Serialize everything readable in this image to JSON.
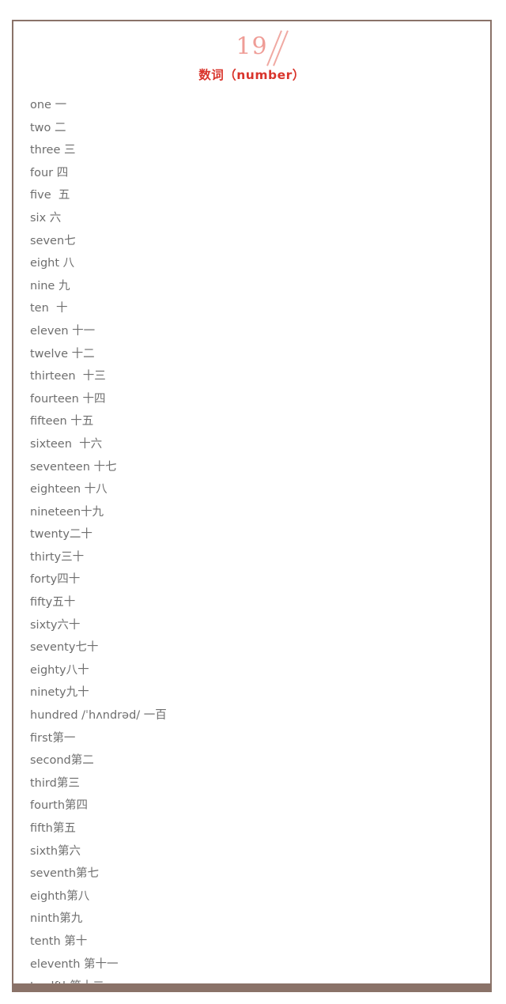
{
  "header": {
    "chapter_number": "19",
    "slash_decoration": "//",
    "section_title_cn": "数词",
    "section_title_open_paren": "（",
    "section_title_en": "number",
    "section_title_close_paren": "）",
    "section_title_full": "数词（number）"
  },
  "colors": {
    "chapter_number": "#ef9c96",
    "section_title": "#d9342b",
    "body_text": "#6e6e6e",
    "border": "#8a7268",
    "footer_bar": "#8a7268",
    "background": "#ffffff"
  },
  "word_list": [
    {
      "english": "one",
      "chinese": "一",
      "text": "one 一"
    },
    {
      "english": "two",
      "chinese": "二",
      "text": "two 二"
    },
    {
      "english": "three",
      "chinese": "三",
      "text": "three 三"
    },
    {
      "english": "four",
      "chinese": "四",
      "text": "four 四"
    },
    {
      "english": "five",
      "chinese": "五",
      "text": "five  五"
    },
    {
      "english": "six",
      "chinese": "六",
      "text": "six 六"
    },
    {
      "english": "seven",
      "chinese": "七",
      "text": "seven七"
    },
    {
      "english": "eight",
      "chinese": "八",
      "text": "eight 八"
    },
    {
      "english": "nine",
      "chinese": "九",
      "text": "nine 九"
    },
    {
      "english": "ten",
      "chinese": "十",
      "text": "ten  十"
    },
    {
      "english": "eleven",
      "chinese": "十一",
      "text": "eleven 十一"
    },
    {
      "english": "twelve",
      "chinese": "十二",
      "text": "twelve 十二"
    },
    {
      "english": "thirteen",
      "chinese": "十三",
      "text": "thirteen  十三"
    },
    {
      "english": "fourteen",
      "chinese": "十四",
      "text": "fourteen 十四"
    },
    {
      "english": "fifteen",
      "chinese": "十五",
      "text": "fifteen 十五"
    },
    {
      "english": "sixteen",
      "chinese": "十六",
      "text": "sixteen  十六"
    },
    {
      "english": "seventeen",
      "chinese": "十七",
      "text": "seventeen 十七"
    },
    {
      "english": "eighteen",
      "chinese": "十八",
      "text": "eighteen 十八"
    },
    {
      "english": "nineteen",
      "chinese": "十九",
      "text": "nineteen十九"
    },
    {
      "english": "twenty",
      "chinese": "二十",
      "text": "twenty二十"
    },
    {
      "english": "thirty",
      "chinese": "三十",
      "text": "thirty三十"
    },
    {
      "english": "forty",
      "chinese": "四十",
      "text": "forty四十"
    },
    {
      "english": "fifty",
      "chinese": "五十",
      "text": "fifty五十"
    },
    {
      "english": "sixty",
      "chinese": "六十",
      "text": "sixty六十"
    },
    {
      "english": "seventy",
      "chinese": "七十",
      "text": "seventy七十"
    },
    {
      "english": "eighty",
      "chinese": "八十",
      "text": "eighty八十"
    },
    {
      "english": "ninety",
      "chinese": "九十",
      "text": "ninety九十"
    },
    {
      "english": "hundred",
      "phonetic": "/ˈhʌndrəd/",
      "chinese": "一百",
      "text": "hundred /ˈhʌndrəd/ 一百"
    },
    {
      "english": "first",
      "chinese": "第一",
      "text": "first第一"
    },
    {
      "english": "second",
      "chinese": "第二",
      "text": "second第二"
    },
    {
      "english": "third",
      "chinese": "第三",
      "text": "third第三"
    },
    {
      "english": "fourth",
      "chinese": "第四",
      "text": "fourth第四"
    },
    {
      "english": "fifth",
      "chinese": "第五",
      "text": "fifth第五"
    },
    {
      "english": "sixth",
      "chinese": "第六",
      "text": "sixth第六"
    },
    {
      "english": "seventh",
      "chinese": "第七",
      "text": "seventh第七"
    },
    {
      "english": "eighth",
      "chinese": "第八",
      "text": "eighth第八"
    },
    {
      "english": "ninth",
      "chinese": "第九",
      "text": "ninth第九"
    },
    {
      "english": "tenth",
      "chinese": "第十",
      "text": "tenth 第十"
    },
    {
      "english": "eleventh",
      "chinese": "第十一",
      "text": "eleventh 第十一"
    },
    {
      "english": "twelfth",
      "chinese": "第十二",
      "text": "twelfth第十二"
    }
  ]
}
